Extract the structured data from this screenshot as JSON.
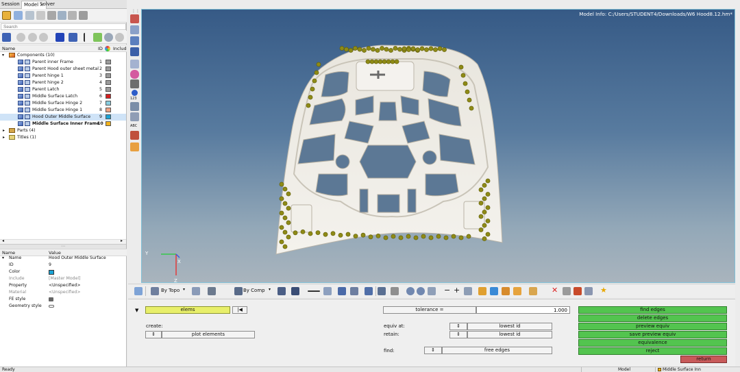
{
  "session_tabs": [
    {
      "label": "Session",
      "active": false
    },
    {
      "label": "Model",
      "active": true,
      "closable": true
    },
    {
      "label": "Solver",
      "active": false
    }
  ],
  "search": {
    "placeholder": "Search"
  },
  "tree": {
    "columns": {
      "name": "Name",
      "id": "ID",
      "include": "Includ"
    },
    "components_label": "Components (10)",
    "components": [
      {
        "name": "Parent inner Frame",
        "id": "1",
        "color": "#9a9a9a",
        "selected": false,
        "bold": false
      },
      {
        "name": "Parent Hood outer sheet metal",
        "id": "2",
        "color": "#9a9a9a",
        "selected": false,
        "bold": false
      },
      {
        "name": "Parent hinge 1",
        "id": "3",
        "color": "#9a9a9a",
        "selected": false,
        "bold": false
      },
      {
        "name": "Parent hinge 2",
        "id": "4",
        "color": "#9a9a9a",
        "selected": false,
        "bold": false
      },
      {
        "name": "Parent Latch",
        "id": "5",
        "color": "#9a9a9a",
        "selected": false,
        "bold": false
      },
      {
        "name": "Middle Surface Latch",
        "id": "6",
        "color": "#d42121",
        "selected": false,
        "bold": false
      },
      {
        "name": "Middle Surface Hinge 2",
        "id": "7",
        "color": "#88cde0",
        "selected": false,
        "bold": false
      },
      {
        "name": "Middle Surface Hinge 1",
        "id": "8",
        "color": "#f0a080",
        "selected": false,
        "bold": false
      },
      {
        "name": "Hood Outer Middle Surface",
        "id": "9",
        "color": "#1aa3d6",
        "selected": true,
        "bold": false
      },
      {
        "name": "Middle Surface Inner Frame",
        "id": "10",
        "color": "#f2b31c",
        "selected": false,
        "bold": true
      }
    ],
    "parts_label": "Parts (4)",
    "titles_label": "Titles (1)"
  },
  "properties": {
    "columns": {
      "name": "Name",
      "value": "Value"
    },
    "rows": [
      {
        "name": "Name",
        "value": "Hood Outer Middle Surface",
        "muted": false
      },
      {
        "name": "ID",
        "value": "9",
        "muted": false
      },
      {
        "name": "Color",
        "value": "",
        "muted": false
      },
      {
        "name": "Include",
        "value": "[Master Model]",
        "muted": true
      },
      {
        "name": "Property",
        "value": "<Unspecified>",
        "muted": false
      },
      {
        "name": "Material",
        "value": "<Unspecified>",
        "muted": true
      },
      {
        "name": "FE style",
        "value": "",
        "muted": false
      },
      {
        "name": "Geometry style",
        "value": "",
        "muted": false
      }
    ],
    "color_value": "#1aa3d6"
  },
  "viewport": {
    "model_info": "Model Info: C:/Users/STUDENT4/Downloads/W6 Hood8.12.hm*",
    "axis_labels": {
      "x": "X",
      "y": "Y",
      "z": "Z"
    }
  },
  "toolbar_bottom": {
    "by_topo": "By Topo",
    "by_comp": "By Comp"
  },
  "panel": {
    "elems": "elems",
    "reset_glyph": "|◀",
    "create_label": "create:",
    "plot_elements": "plot elements",
    "tolerance_label": "tolerance =",
    "tolerance_value": "1.000",
    "equiv_at_label": "equiv at:",
    "equiv_at_value": "lowest id",
    "retain_label": "retain:",
    "retain_value": "lowest id",
    "find_label": "find:",
    "find_value": "free edges",
    "actions": [
      "find edges",
      "delete edges",
      "preview equiv",
      "save preview equiv",
      "equivalence",
      "reject"
    ],
    "return_label": "return"
  },
  "status": {
    "left": "Ready",
    "model": "Model",
    "component": "Middle Surface Inn"
  },
  "colors": {
    "accent_green": "#53c44f",
    "return_red": "#c85a5a",
    "elems_yellow": "#e8ef6a",
    "viewport_top": "#365a86"
  }
}
